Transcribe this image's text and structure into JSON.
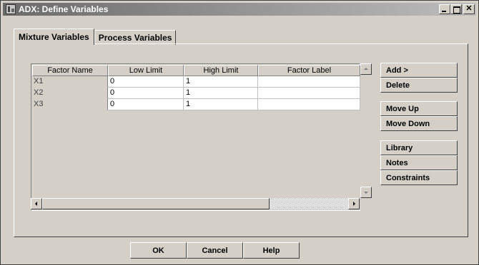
{
  "window": {
    "title": "ADX: Define Variables"
  },
  "tabs": [
    {
      "label": "Mixture Variables",
      "active": true
    },
    {
      "label": "Process Variables",
      "active": false
    }
  ],
  "grid": {
    "columns": [
      "Factor Name",
      "Low Limit",
      "High Limit",
      "Factor Label"
    ],
    "rows": [
      {
        "name": "X1",
        "low": "0",
        "high": "1",
        "label": ""
      },
      {
        "name": "X2",
        "low": "0",
        "high": "1",
        "label": ""
      },
      {
        "name": "X3",
        "low": "0",
        "high": "1",
        "label": ""
      }
    ]
  },
  "side_buttons": {
    "add": "Add >",
    "delete": "Delete",
    "move_up": "Move Up",
    "move_down": "Move Down",
    "library": "Library",
    "notes": "Notes",
    "constraints": "Constraints"
  },
  "bottom_buttons": {
    "ok": "OK",
    "cancel": "Cancel",
    "help": "Help"
  }
}
